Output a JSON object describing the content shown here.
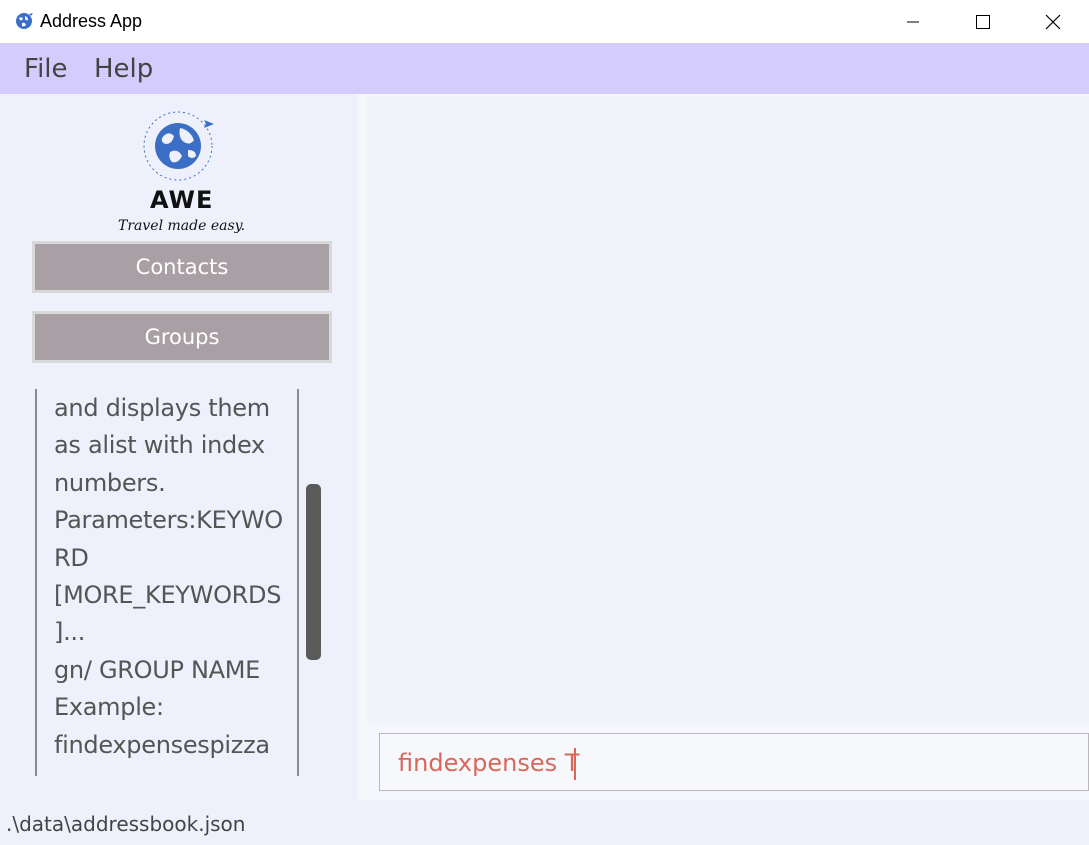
{
  "window": {
    "title": "Address App",
    "icon": "globe-icon"
  },
  "menu": {
    "file_label": "File",
    "help_label": "Help"
  },
  "logo": {
    "name": "AWE",
    "tagline": "Travel made easy."
  },
  "sidebar": {
    "contacts_label": "Contacts",
    "groups_label": "Groups"
  },
  "help_text": {
    "lines": [
      "and displays them",
      "as alist with index",
      "numbers.",
      "Parameters:KEYWO",
      "RD",
      "[MORE_KEYWORDS",
      "]...",
      "gn/ GROUP NAME",
      "Example:",
      "findexpensespizza"
    ]
  },
  "command": {
    "value": "findexpenses T"
  },
  "status": {
    "file_path": ".\\data\\addressbook.json"
  },
  "colors": {
    "menubar": "#d5ccfe",
    "button": "#a9a0a5",
    "command_text": "#d8675b",
    "panel": "#eef1fb"
  }
}
